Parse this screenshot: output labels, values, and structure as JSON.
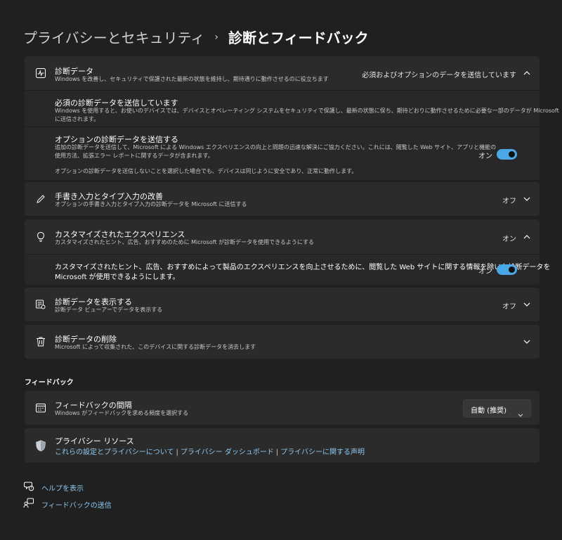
{
  "breadcrumb": {
    "parent": "プライバシーとセキュリティ",
    "separator": "›",
    "current": "診断とフィードバック"
  },
  "diagnostic_data": {
    "title": "診断データ",
    "description": "Windows を改善し、セキュリティで保護された最新の状態を維持し、期待通りに動作させるのに役立ちます",
    "status": "必須およびオプションのデータを送信しています",
    "required": {
      "title": "必須の診断データを送信しています",
      "description_line1": "Windows を使用すると、お使いのデバイスでは、デバイスとオペレーティング システムをセキュリティで保護し、最新の状態に保ち、期待どおりに動作させるために必要な一部のデータが Microsoft",
      "description_line2": "に送信されます。"
    },
    "optional": {
      "title": "オプションの診断データを送信する",
      "description_line1": "追加の診断データを送信して、Microsoft による Windows エクスペリエンスの向上と問題の迅速な解決にご協力ください。これには、閲覧した Web サイト、アプリと機能の",
      "description_line2": "使用方法、拡張エラー レポートに関するデータが含まれます。",
      "note": "オプションの診断データを送信しないことを選択した場合でも、デバイスは同じように安全であり、正常に動作します。",
      "toggle_label": "オン"
    }
  },
  "inking": {
    "title": "手書き入力とタイプ入力の改善",
    "description": "オプションの手書き入力とタイプ入力の診断データを Microsoft に送信する",
    "status": "オフ"
  },
  "tailored": {
    "title": "カスタマイズされたエクスペリエンス",
    "description": "カスタマイズされたヒント、広告、おすすめのために Microsoft が診断データを使用できるようにする",
    "status": "オン",
    "detail_line1": "カスタマイズされたヒント、広告、おすすめによって製品のエクスペリエンスを向上させるために、閲覧した Web サイトに関する情報を除いた診断データを",
    "detail_line2": "Microsoft が使用できるようにします。",
    "toggle_label": "オン"
  },
  "view_data": {
    "title": "診断データを表示する",
    "description": "診断データ ビューアーでデータを表示する",
    "status": "オフ"
  },
  "delete_data": {
    "title": "診断データの削除",
    "description": "Microsoft によって収集された、このデバイスに関する診断データを消去します"
  },
  "feedback_section": {
    "heading": "フィードバック",
    "frequency": {
      "title": "フィードバックの間隔",
      "description": "Windows がフィードバックを求める頻度を選択する",
      "selected": "自動 (推奨)"
    },
    "privacy": {
      "title": "プライバシー リソース",
      "link1": "これらの設定とプライバシーについて",
      "link2": "プライバシー ダッシュボード",
      "link3": "プライバシーに関する声明",
      "separator": "|"
    }
  },
  "footer": {
    "help": "ヘルプを表示",
    "feedback": "フィードバックの送信"
  },
  "colors": {
    "background": "#202020",
    "card": "#2b2b2b",
    "accent": "#4aa8e6",
    "link": "#8ec8f0"
  },
  "icons": [
    "activity-icon",
    "chevron-up-icon",
    "chevron-down-icon",
    "pen-icon",
    "lightbulb-icon",
    "data-viewer-icon",
    "trash-icon",
    "calendar-icon",
    "shield-icon",
    "help-icon",
    "feedback-icon"
  ]
}
